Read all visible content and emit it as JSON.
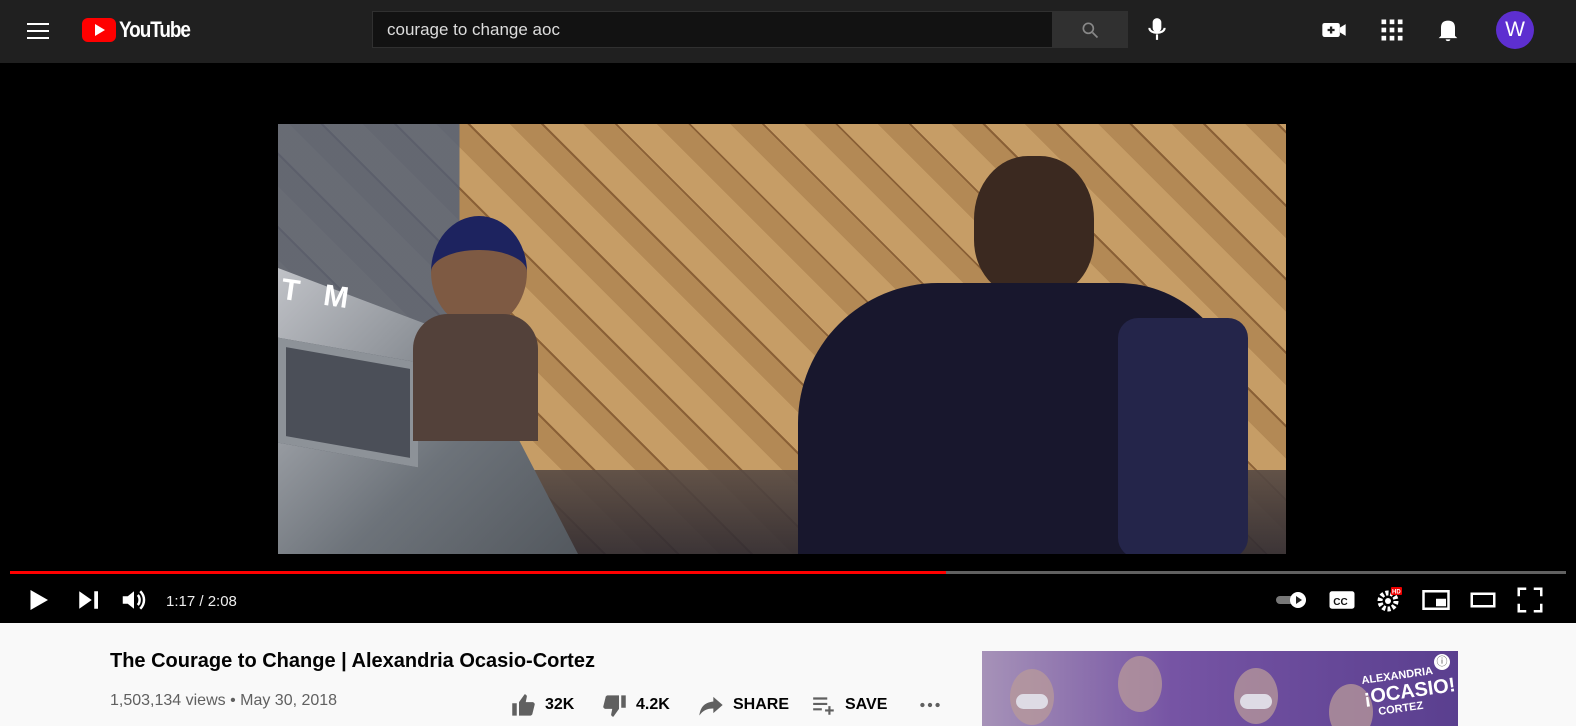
{
  "header": {
    "logo_text": "YouTube",
    "search_value": "courage to change aoc",
    "avatar_letter": "W"
  },
  "player": {
    "time_display": "1:17 / 2:08",
    "progress_fraction": 0.6016,
    "overlay_text": "T M"
  },
  "video_info": {
    "title": "The Courage to Change | Alexandria Ocasio-Cortez",
    "meta": "1,503,134 views • May 30, 2018",
    "likes": "32K",
    "dislikes": "4.2K",
    "share_label": "SHARE",
    "save_label": "SAVE"
  },
  "advertisement": {
    "logo_top": "ALEXANDRIA",
    "logo_main": "¡OCASIO!",
    "logo_bottom": "CORTEZ",
    "info_symbol": "ⓘ"
  }
}
